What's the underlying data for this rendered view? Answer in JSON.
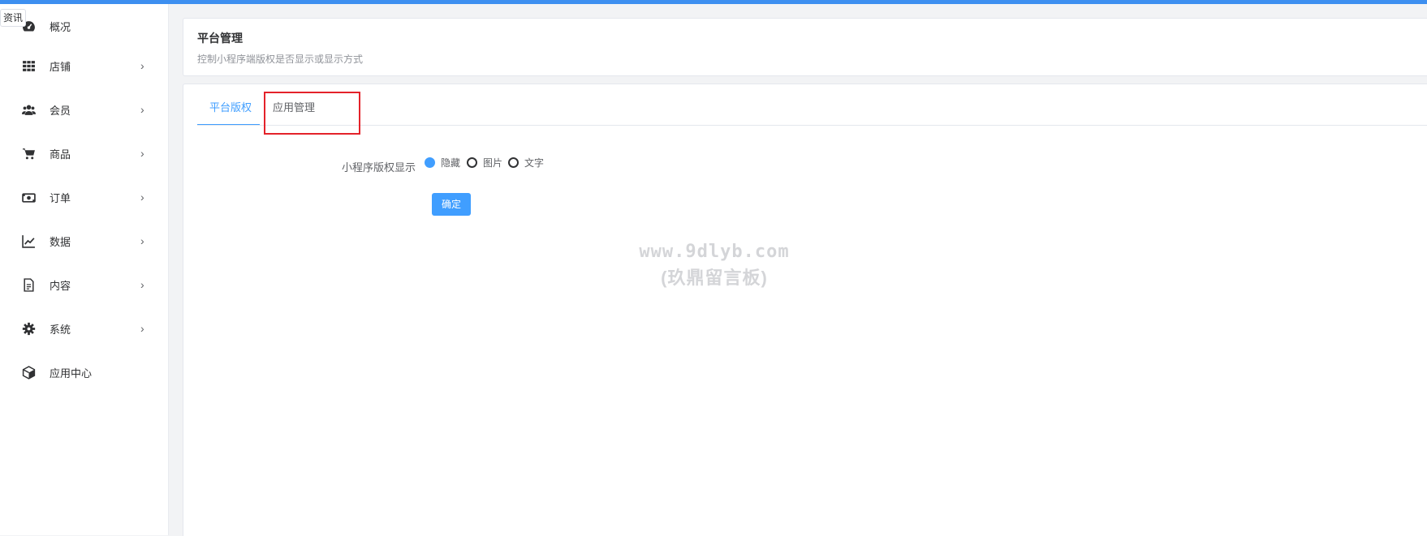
{
  "sidebar": {
    "tag": "资讯",
    "items": [
      {
        "label": "概况",
        "icon": "dashboard-icon",
        "has_chevron": false
      },
      {
        "label": "店铺",
        "icon": "grid-icon",
        "has_chevron": true
      },
      {
        "label": "会员",
        "icon": "users-icon",
        "has_chevron": true
      },
      {
        "label": "商品",
        "icon": "cart-icon",
        "has_chevron": true
      },
      {
        "label": "订单",
        "icon": "money-icon",
        "has_chevron": true
      },
      {
        "label": "数据",
        "icon": "chart-line-icon",
        "has_chevron": true
      },
      {
        "label": "内容",
        "icon": "document-icon",
        "has_chevron": true
      },
      {
        "label": "系统",
        "icon": "gear-icon",
        "has_chevron": true
      },
      {
        "label": "应用中心",
        "icon": "cube-icon",
        "has_chevron": false
      }
    ],
    "chevron": "›"
  },
  "header": {
    "title": "平台管理",
    "description": "控制小程序端版权是否显示或显示方式"
  },
  "tabs": [
    {
      "label": "平台版权",
      "active": true
    },
    {
      "label": "应用管理",
      "active": false
    }
  ],
  "form": {
    "label": "小程序版权显示",
    "options": [
      {
        "label": "隐藏",
        "selected": true
      },
      {
        "label": "图片",
        "selected": false
      },
      {
        "label": "文字",
        "selected": false
      }
    ],
    "submit_label": "确定"
  },
  "watermark": {
    "line1": "www.9dlyb.com",
    "line2": "(玖鼎留言板)"
  },
  "colors": {
    "accent": "#409eff",
    "topbar": "#3d8ff0",
    "highlight": "#e4222a"
  }
}
